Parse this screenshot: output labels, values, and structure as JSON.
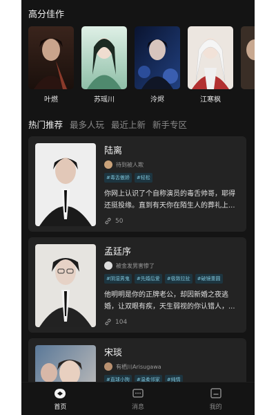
{
  "featured": {
    "title": "高分佳作",
    "items": [
      {
        "name": "叶燃",
        "palette": [
          "#2a1a14",
          "#8a3a2a"
        ]
      },
      {
        "name": "苏瑶川",
        "palette": [
          "#cfe6dc",
          "#4f8a6e"
        ]
      },
      {
        "name": "泠烬",
        "palette": [
          "#0c1a3a",
          "#2b4d9a"
        ]
      },
      {
        "name": "江寒枫",
        "palette": [
          "#e9e2dc",
          "#b23030"
        ]
      },
      {
        "name": "",
        "palette": [
          "#2a2420",
          "#7a5a40"
        ]
      }
    ]
  },
  "tabs": [
    "热门推荐",
    "最多人玩",
    "最近上新",
    "新手专区"
  ],
  "cards": [
    {
      "name": "陆离",
      "author": "待到被人欺",
      "tags": [
        "#毒舌傲娇",
        "#轻松"
      ],
      "desc": "你网上认识了个自称演员的毒舌帅哥，耶得还挺投缘。直到有天你在陌生人的葬礼上...",
      "count": "50",
      "palette": [
        "#f1f1f1",
        "#1a1a1a"
      ],
      "avatar": "#c9a27a"
    },
    {
      "name": "孟廷序",
      "author": "被金发男害惨了",
      "tags": [
        "#阴湿男鬼",
        "#先婚后爱",
        "#极致拉扯",
        "#破镜重圆"
      ],
      "desc": "他明明是你的正牌老公，却因新婚之夜逃婚，让双眼有疾，天生弱视的你认错人，...",
      "count": "104",
      "palette": [
        "#e8e6e2",
        "#222222"
      ],
      "avatar": "#dddddd"
    },
    {
      "name": "宋琰",
      "author": "有栖川Arisugawa",
      "tags": [
        "#直球小狗",
        "#温柔邻家",
        "#纯情"
      ],
      "desc": "",
      "count": "",
      "palette": [
        "#6a86a8",
        "#d8cfc6"
      ],
      "avatar": "#b89070"
    }
  ],
  "nav": [
    {
      "label": "首页",
      "active": true
    },
    {
      "label": "消息",
      "active": false
    },
    {
      "label": "我的",
      "active": false
    }
  ]
}
